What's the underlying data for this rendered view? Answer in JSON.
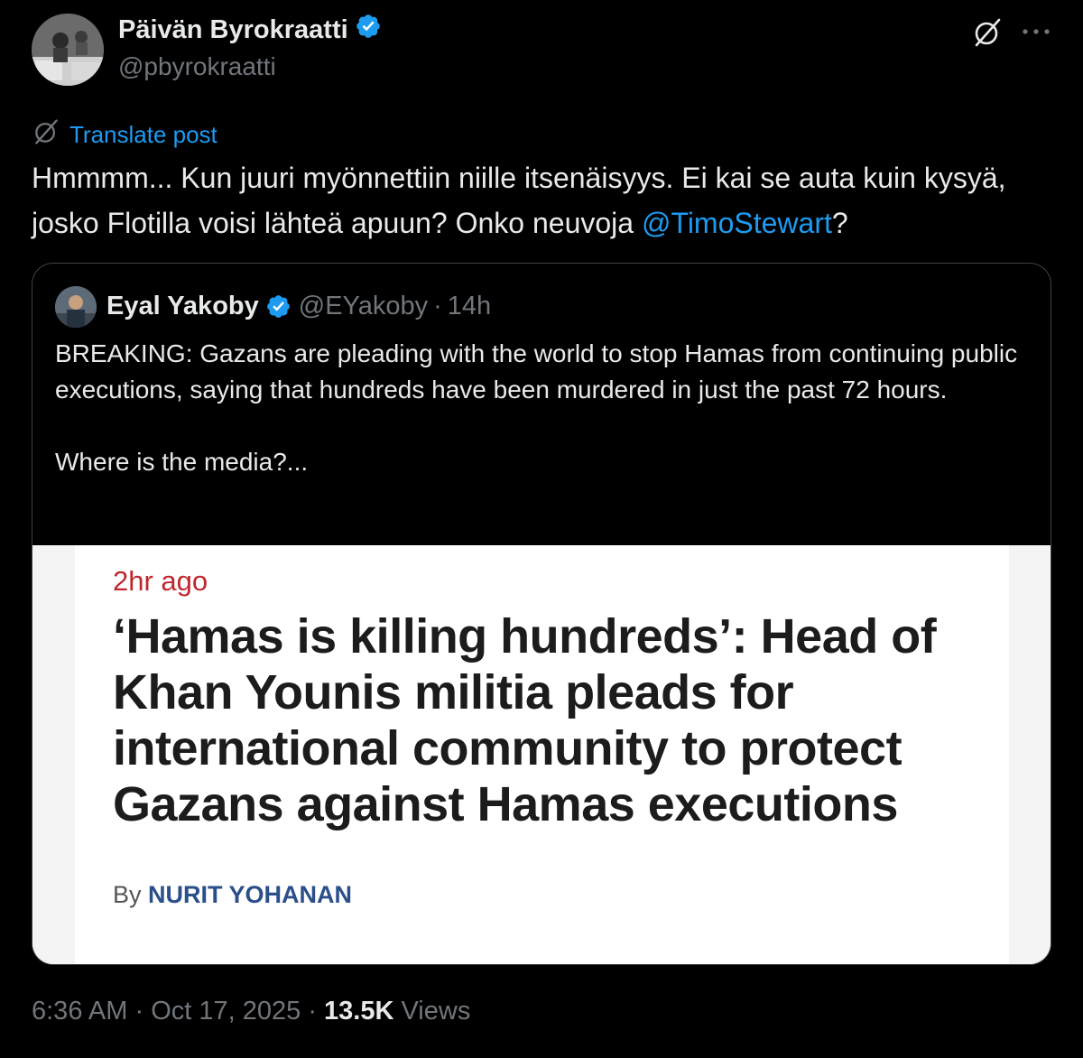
{
  "post": {
    "author_name": "Päivän Byrokraatti",
    "author_handle": "@pbyrokraatti",
    "translate_label": "Translate post",
    "text_before_mention": "Hmmmm... Kun juuri myönnettiin niille itsenäisyys. Ei kai se auta kuin kysyä, josko Flotilla voisi lähteä apuun? Onko neuvoja ",
    "mention": "@TimoStewart",
    "text_after_mention": "?",
    "time": "6:36 AM",
    "date": "Oct 17, 2025",
    "views_count": "13.5K",
    "views_label": "Views"
  },
  "quoted": {
    "author_name": "Eyal Yakoby",
    "author_handle": "@EYakoby",
    "separator": "·",
    "time": "14h",
    "text_para1": "BREAKING: Gazans are pleading with the world to stop Hamas from continuing public executions, saying that hundreds have been murdered in just the past 72 hours.",
    "text_para2": "Where is the media?...",
    "media": {
      "time_ago": "2hr ago",
      "headline": "‘Hamas is killing hundreds’: Head of Khan Younis militia pleads for international community to protect Gazans against Hamas executions",
      "byline_prefix": "By",
      "byline_author": "NURIT YOHANAN"
    }
  },
  "colors": {
    "background": "#000000",
    "text": "#e7e9ea",
    "secondary": "#71767b",
    "link": "#1d9bf0",
    "verified": "#1d9bf0",
    "headline_time": "#c0272d",
    "byline_author": "#2b4f8a"
  },
  "icons": [
    "verified-badge-icon",
    "grok-icon",
    "more-icon",
    "translate-icon"
  ]
}
